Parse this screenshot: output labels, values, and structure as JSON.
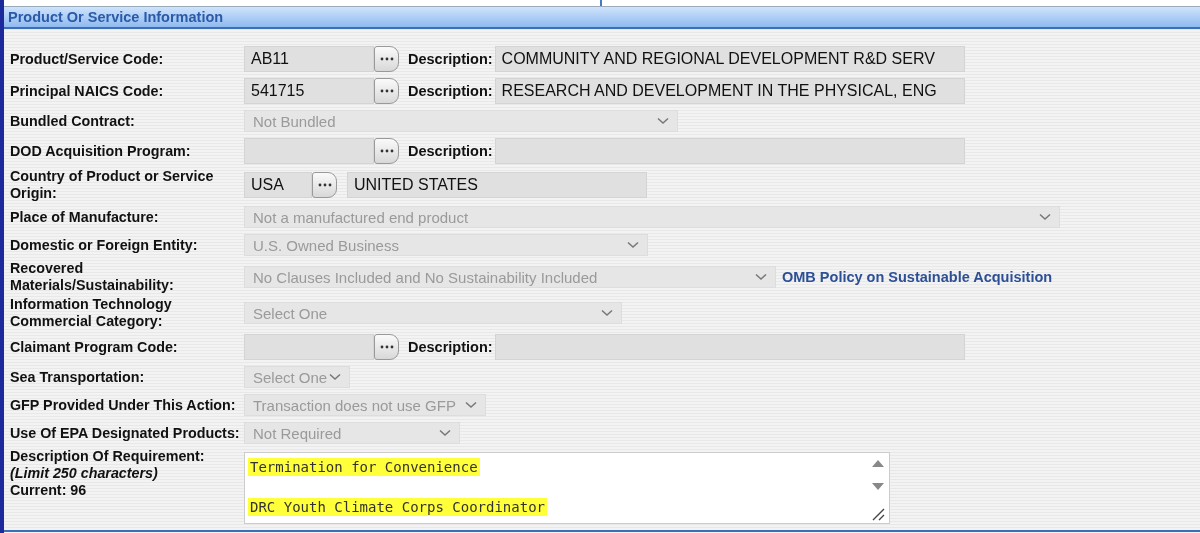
{
  "section": {
    "title": "Product Or Service Information"
  },
  "fields": [
    {
      "kind": "lookup",
      "label": "Product/Service Code:",
      "code": "AB11",
      "description_label": "Description:",
      "description": "COMMUNITY AND REGIONAL DEVELOPMENT R&D SERV"
    },
    {
      "kind": "lookup",
      "label": "Principal NAICS Code:",
      "code": "541715",
      "description_label": "Description:",
      "description": "RESEARCH AND DEVELOPMENT IN THE PHYSICAL, ENG"
    },
    {
      "kind": "select",
      "label": "Bundled Contract:",
      "value": "Not Bundled",
      "disabled": true
    },
    {
      "kind": "lookup",
      "label": "DOD Acquisition Program:",
      "description_label": "Description:"
    },
    {
      "kind": "country",
      "label": "Country of Product or Service Origin:",
      "code": "USA",
      "name": "UNITED STATES"
    },
    {
      "kind": "select",
      "label": "Place of Manufacture:",
      "value": "Not a manufactured end product",
      "disabled": true
    },
    {
      "kind": "select",
      "label": "Domestic or Foreign Entity:",
      "value": "U.S. Owned Business",
      "disabled": true
    },
    {
      "kind": "select",
      "label": "Recovered Materials/Sustainability:",
      "value": "No Clauses Included and No Sustainability Included",
      "disabled": true,
      "link": "OMB Policy on Sustainable Acquisition"
    },
    {
      "kind": "select",
      "label": "Information Technology Commercial Category:",
      "value": "Select One",
      "disabled": true
    },
    {
      "kind": "lookup",
      "label": "Claimant Program Code:",
      "description_label": "Description:"
    },
    {
      "kind": "select",
      "label": "Sea Transportation:",
      "value": "Select One",
      "disabled": true
    },
    {
      "kind": "select",
      "label": "GFP Provided Under This Action:",
      "value": "Transaction does not use GFP",
      "disabled": true
    },
    {
      "kind": "select",
      "label": "Use Of EPA Designated Products:",
      "value": "Not Required",
      "disabled": true
    },
    {
      "kind": "textarea",
      "label": "Description Of Requirement:",
      "note": "(Limit 250 characters)",
      "count": "Current: 96",
      "lines": [
        {
          "text": "Termination for Convenience",
          "highlighted": true
        },
        {
          "text": "DRC Youth Climate Corps Coordinator",
          "highlighted": true
        }
      ]
    }
  ]
}
